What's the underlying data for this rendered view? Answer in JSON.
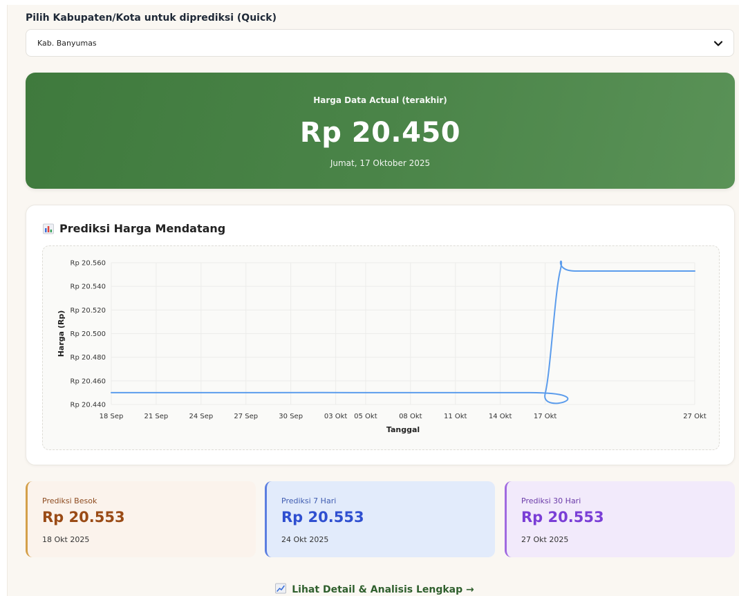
{
  "selector": {
    "label": "Pilih Kabupaten/Kota untuk diprediksi (Quick)",
    "selected": "Kab. Banyumas"
  },
  "hero": {
    "label": "Harga Data Actual (terakhir)",
    "value": "Rp 20.450",
    "date": "Jumat, 17 Oktober 2025"
  },
  "chart_section": {
    "title": "Prediksi Harga Mendatang",
    "icon": "bar-chart-icon"
  },
  "chart_data": {
    "type": "line",
    "xlabel": "Tanggal",
    "ylabel": "Harga (Rp)",
    "ylim": [
      20440,
      20560
    ],
    "yticks": [
      20560,
      20540,
      20520,
      20500,
      20480,
      20460,
      20440
    ],
    "ytick_labels": [
      "Rp 20.560",
      "Rp 20.540",
      "Rp 20.520",
      "Rp 20.500",
      "Rp 20.480",
      "Rp 20.460",
      "Rp 20.440"
    ],
    "xtick_labels": [
      "18 Sep",
      "21 Sep",
      "24 Sep",
      "27 Sep",
      "30 Sep",
      "03 Okt",
      "05 Okt",
      "08 Okt",
      "11 Okt",
      "14 Okt",
      "17 Okt",
      "27 Okt"
    ],
    "xtick_dates": [
      "2025-09-18",
      "2025-09-21",
      "2025-09-24",
      "2025-09-27",
      "2025-09-30",
      "2025-10-03",
      "2025-10-05",
      "2025-10-08",
      "2025-10-11",
      "2025-10-14",
      "2025-10-17",
      "2025-10-27"
    ],
    "grid": true,
    "line_color": "#5b9cec",
    "series": [
      {
        "x": [
          "2025-09-18",
          "2025-10-16",
          "2025-10-17",
          "2025-10-18",
          "2025-10-19",
          "2025-10-27"
        ],
        "y": [
          20450,
          20450,
          20449,
          20553,
          20553,
          20553
        ]
      }
    ]
  },
  "predictions": [
    {
      "label": "Prediksi Besok",
      "value": "Rp 20.553",
      "date": "18 Okt 2025"
    },
    {
      "label": "Prediksi 7 Hari",
      "value": "Rp 20.553",
      "date": "24 Okt 2025"
    },
    {
      "label": "Prediksi 30 Hari",
      "value": "Rp 20.553",
      "date": "27 Okt 2025"
    }
  ],
  "detail_link": {
    "label": "Lihat Detail & Analisis Lengkap →",
    "icon": "chart-up-icon"
  }
}
